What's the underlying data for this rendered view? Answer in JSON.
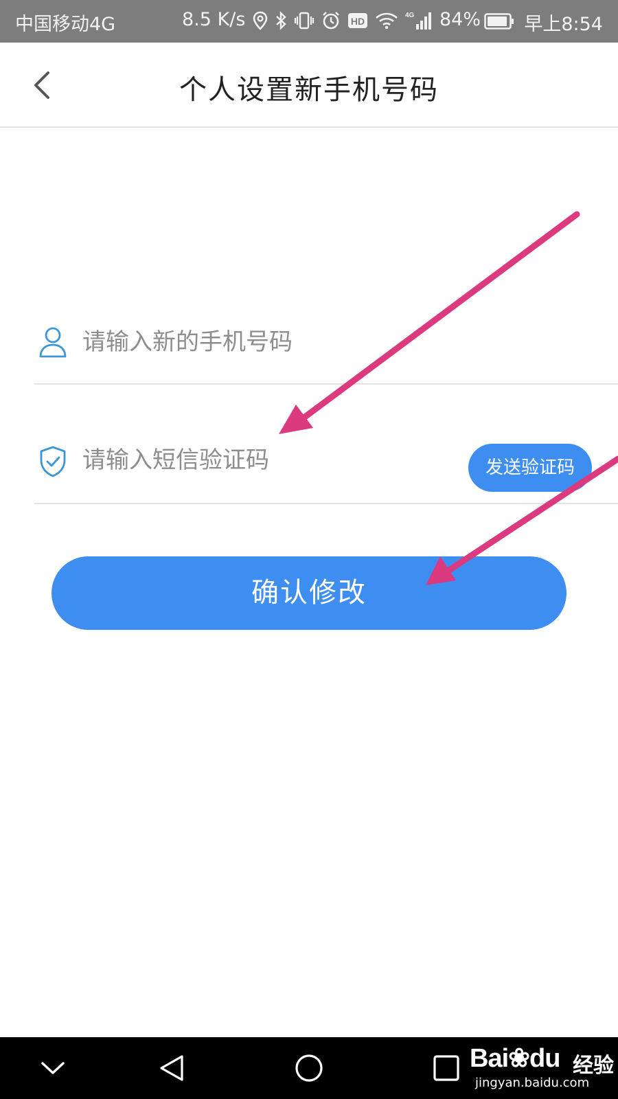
{
  "status_bar": {
    "carrier": "中国移动4G",
    "net_speed": "8.5 K/s",
    "hd_badge": "HD",
    "signal_label": "4G",
    "battery_percent": "84%",
    "time": "早上8:54",
    "icons": [
      "location-icon",
      "bluetooth-icon",
      "vibrate-icon",
      "alarm-icon",
      "hd-icon",
      "wifi-icon",
      "signal-icon",
      "battery-icon"
    ]
  },
  "header": {
    "title": "个人设置新手机号码",
    "back_icon": "chevron-left-icon"
  },
  "form": {
    "phone": {
      "icon": "user-icon",
      "placeholder": "请输入新的手机号码",
      "value": ""
    },
    "code": {
      "icon": "shield-check-icon",
      "placeholder": "请输入短信验证码",
      "value": "",
      "send_button_label": "发送验证码"
    },
    "confirm_label": "确认修改"
  },
  "colors": {
    "accent": "#3d8ef0",
    "annotation_arrow": "#dc3a7e",
    "status_bar_bg": "#7d7d7d",
    "nav_bar_bg": "#000000"
  },
  "nav_bar": {
    "icons": [
      "chevron-down-icon",
      "back-triangle-icon",
      "home-circle-icon",
      "recent-square-icon"
    ]
  },
  "watermark": {
    "brand": "Bai",
    "brand_suffix": "du",
    "title": "经验",
    "url": "jingyan.baidu.com"
  }
}
